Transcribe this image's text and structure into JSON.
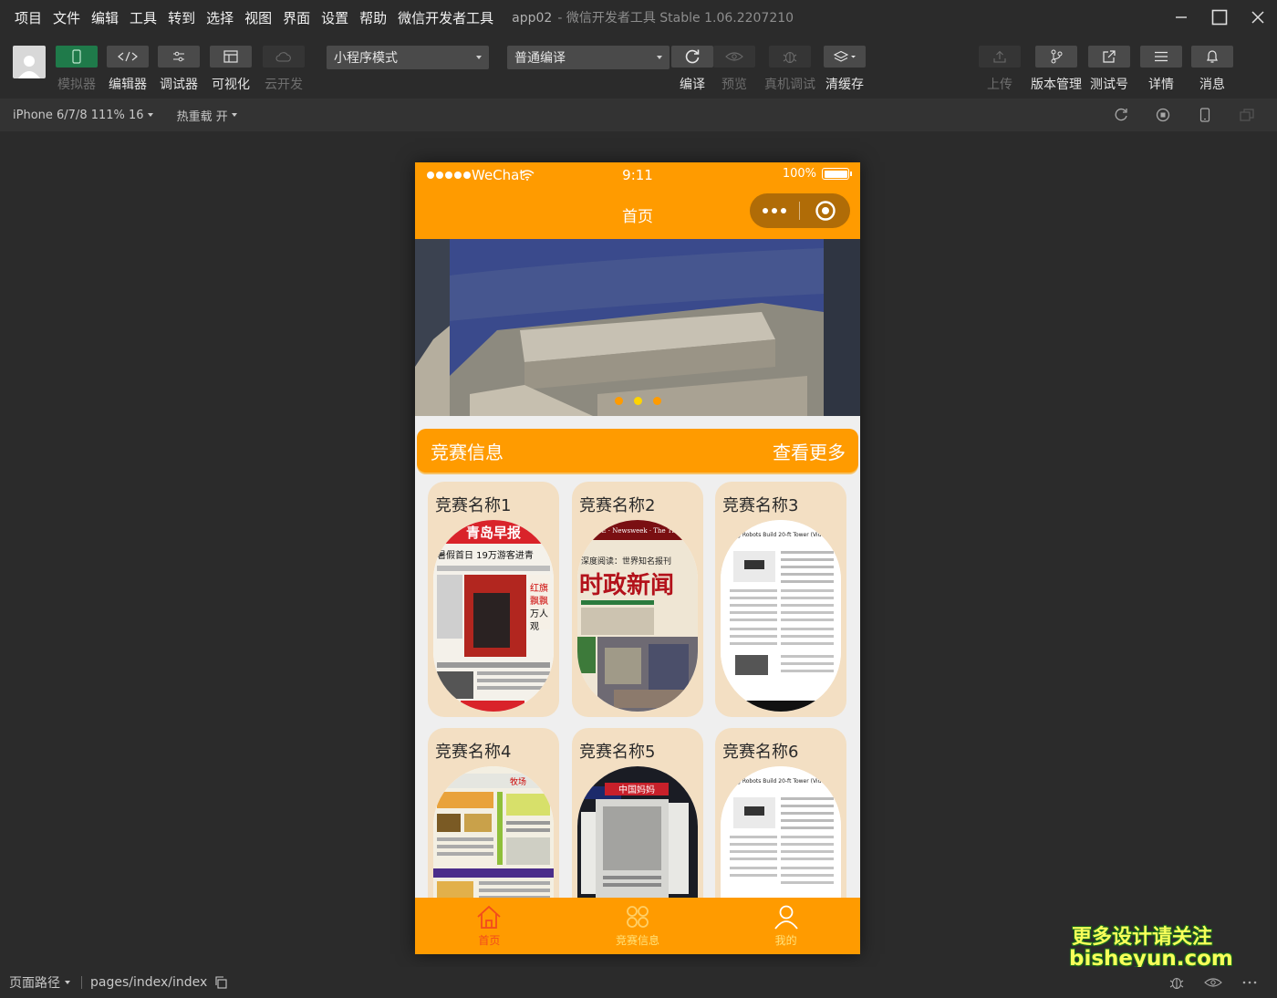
{
  "menu": [
    "项目",
    "文件",
    "编辑",
    "工具",
    "转到",
    "选择",
    "视图",
    "界面",
    "设置",
    "帮助",
    "微信开发者工具"
  ],
  "window": {
    "app_name": "app02",
    "title": "- 微信开发者工具 Stable 1.06.2207210"
  },
  "toolbar": {
    "simulator": "模拟器",
    "editor": "编辑器",
    "debugger": "调试器",
    "visual": "可视化",
    "cloud": "云开发",
    "mode_select": "小程序模式",
    "compile_select": "普通编译",
    "compile": "编译",
    "preview": "预览",
    "remote_debug": "真机调试",
    "clear_cache": "清缓存",
    "upload": "上传",
    "version": "版本管理",
    "test_account": "测试号",
    "details": "详情",
    "messages": "消息"
  },
  "devbar": {
    "device": "iPhone 6/7/8 111% 16",
    "hot_reload": "热重载 开"
  },
  "phone": {
    "carrier": "WeChat",
    "time": "9:11",
    "battery": "100%",
    "nav_title": "首页",
    "banner_dots": 3,
    "banner_active_dot": 1,
    "section_title": "竞赛信息",
    "section_more": "查看更多",
    "cards": [
      "竞赛名称1",
      "竞赛名称2",
      "竞赛名称3",
      "竞赛名称4",
      "竞赛名称5",
      "竞赛名称6"
    ],
    "card_images": [
      {
        "headline": "青岛早报",
        "line1": "暑假首日 19万游客进青",
        "line2": "红旗飘飘 万人观"
      },
      {
        "headline": "时政新闻",
        "line1": "TIME · Newsweek · The Times",
        "line2": "深度阅读：世界知名报刊"
      },
      {
        "headline": "Flying Robots Build 20-ft Tower (Video)",
        "line1": "",
        "line2": ""
      },
      {
        "headline": "牧场",
        "line1": "",
        "line2": ""
      },
      {
        "headline": "中国妈妈",
        "line1": "",
        "line2": ""
      },
      {
        "headline": "Flying Robots Build 20-ft Tower (Video)",
        "line1": "",
        "line2": ""
      }
    ],
    "tabs": [
      "首页",
      "竞赛信息",
      "我的"
    ],
    "active_tab": 0
  },
  "footer": {
    "path_label": "页面路径",
    "path": "pages/index/index"
  },
  "watermark": {
    "line1": "更多设计请关注",
    "line2": "bisheyun.com"
  },
  "colors": {
    "accent": "#ff9b00",
    "active_tab": "#f24b1d",
    "card_bg": "#f3dfc3"
  }
}
